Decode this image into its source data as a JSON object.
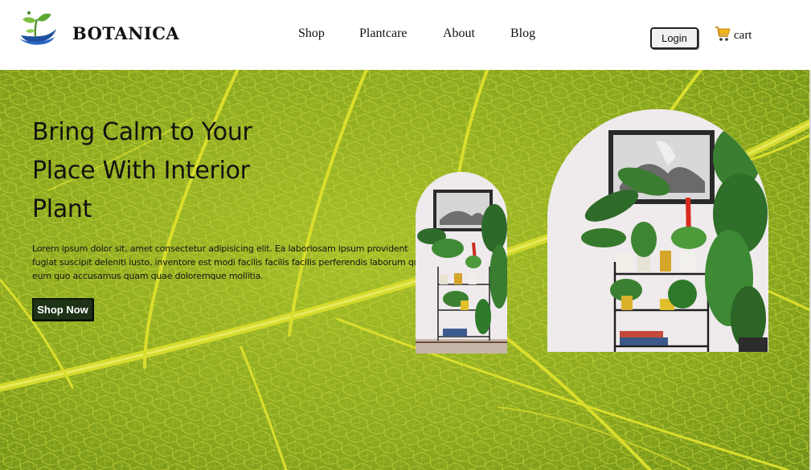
{
  "brand": {
    "name": "BOTANICA",
    "logo_icon": "seedling-hands-icon"
  },
  "nav": {
    "items": [
      {
        "label": "Shop"
      },
      {
        "label": "Plantcare"
      },
      {
        "label": "About"
      },
      {
        "label": "Blog"
      }
    ],
    "login_label": "Login",
    "cart_label": "cart",
    "cart_icon": "shopping-cart-icon"
  },
  "hero": {
    "title": "Bring Calm to Your Place With Interior Plant",
    "description": "Lorem ipsum dolor sit, amet consectetur adipisicing elit. Ea laboriosam ipsum provident fugiat suscipit deleniti iusto, inventore est modi facilis facilis facilis perferendis laborum quia eum quo accusamus quam quae doloremque mollitia.",
    "cta_label": "Shop Now",
    "background": "leaf-texture",
    "images": [
      "plant-shelf-arch-small",
      "plant-shelf-arch-large"
    ]
  },
  "colors": {
    "leaf_green": "#8fac22",
    "leaf_vein": "#d8dc2a",
    "cta_bg": "#1f3317",
    "text_dark": "#121212"
  }
}
